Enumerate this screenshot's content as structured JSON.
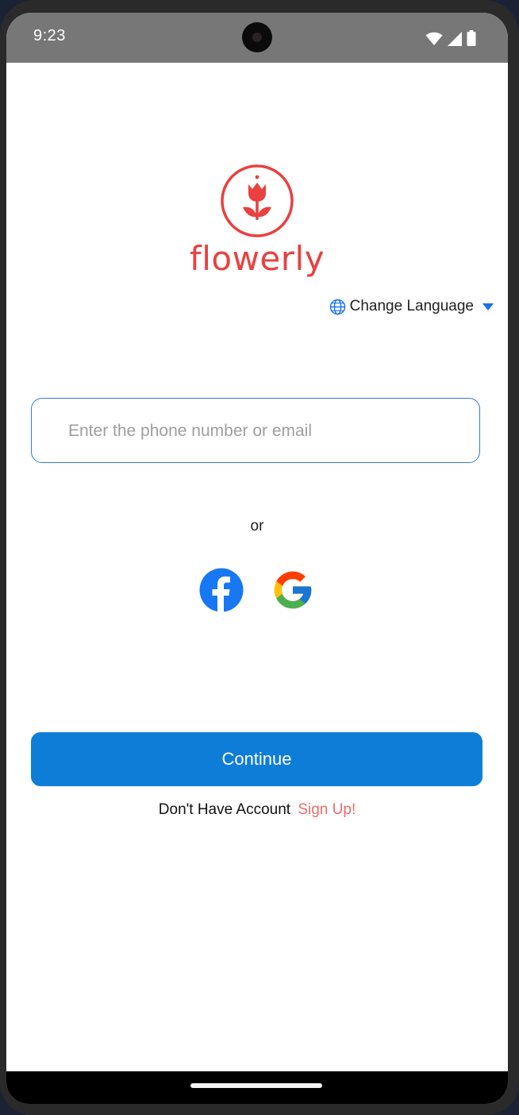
{
  "status_bar": {
    "time": "9:23",
    "icons": [
      "wifi-icon",
      "cell-signal-icon",
      "battery-icon"
    ]
  },
  "logo": {
    "wordmark": "flowerly",
    "brand_color": "#e8413f"
  },
  "language": {
    "label": "Change Language",
    "icon": "globe-icon",
    "accent_color": "#1a73e8"
  },
  "login": {
    "input_placeholder": "Enter the phone number or email",
    "input_value": "",
    "or_text": "or",
    "social": [
      "facebook-icon",
      "google-icon"
    ],
    "continue_label": "Continue",
    "continue_color": "#0e7dd8",
    "no_account_text": "Don't Have Account",
    "signup_label": "Sign Up!",
    "signup_color": "#f06a6a"
  }
}
